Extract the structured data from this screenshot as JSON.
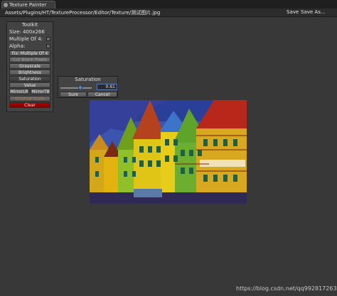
{
  "window": {
    "tab_label": "Texture Painter",
    "tab_icon": "unity-icon"
  },
  "pathbar": {
    "path": "Assets/Plugins/HT/TextureProcessor/Editor/Texture/测试图片.jpg",
    "save_label": "Save",
    "save_as_label": "Save As..."
  },
  "toolkit": {
    "title": "Toolkit",
    "size_label": "Size: 400x266",
    "multiple_label": "Multiple Of 4:",
    "alpha_label": "Alpha:",
    "buttons": [
      {
        "label": "Fix: Multiple Of 4"
      },
      {
        "label": "Cut Blank Pixels"
      },
      {
        "label": "Grayscale"
      },
      {
        "label": "Brightness"
      },
      {
        "label": "Saturation"
      },
      {
        "label": "Value"
      },
      {
        "label": "MirrorLR"
      },
      {
        "label": "MirrorTB"
      },
      {
        "label": "Original Scale"
      },
      {
        "label": "Clear"
      }
    ]
  },
  "saturation_popup": {
    "title": "Saturation",
    "value": "0.61",
    "slider_level": 0.61,
    "sure_label": "Sure",
    "cancel_label": "Cancel"
  },
  "watermark": "https://blog.csdn.net/qq992817263",
  "colors": {
    "background": "#383838",
    "panel": "#434343",
    "clear_button": "#b30000",
    "accent": "#5a78b8"
  }
}
